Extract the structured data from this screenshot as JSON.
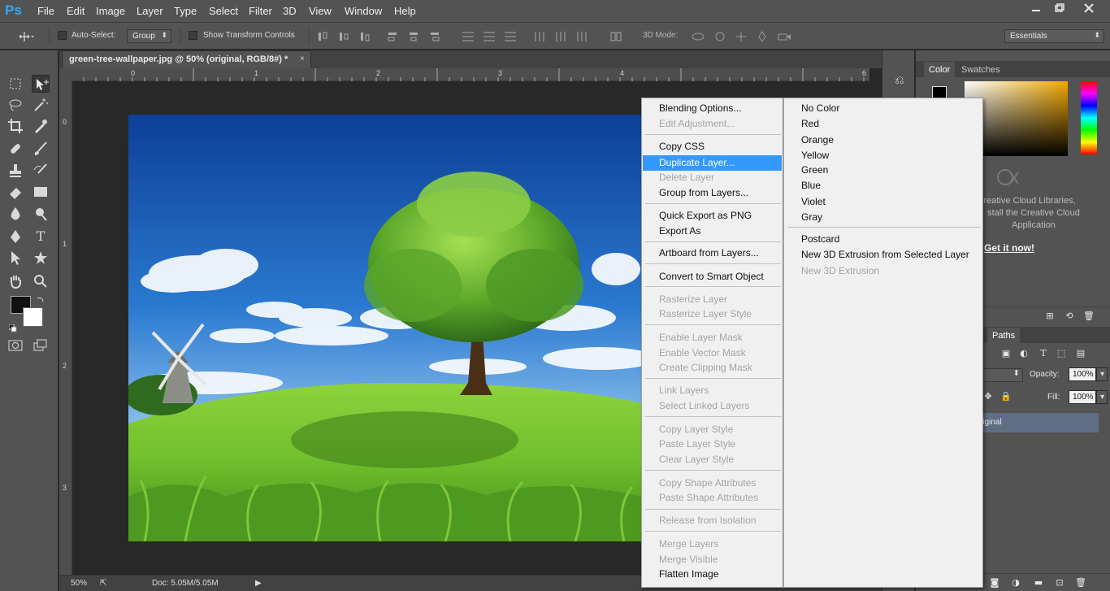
{
  "app": {
    "logo": "Ps",
    "menu": [
      "File",
      "Edit",
      "Image",
      "Layer",
      "Type",
      "Select",
      "Filter",
      "3D",
      "View",
      "Window",
      "Help"
    ],
    "window_controls": [
      "minimize-icon",
      "restore-icon",
      "close-icon"
    ]
  },
  "options_bar": {
    "auto_select_label": "Auto-Select:",
    "auto_select_value": "Group",
    "show_transform_label": "Show Transform Controls",
    "mode_3d_label": "3D Mode:",
    "workspace_value": "Essentials"
  },
  "document": {
    "tab_title": "green-tree-wallpaper.jpg @ 50% (original, RGB/8#) *",
    "close_glyph": "×",
    "ruler_h_numbers": [
      "0",
      "1",
      "2",
      "3",
      "4",
      "6"
    ],
    "ruler_v_numbers": [
      "0",
      "1",
      "2",
      "3"
    ]
  },
  "status_bar": {
    "zoom": "50%",
    "doc_size": "Doc: 5.05M/5.05M"
  },
  "color_panel": {
    "tabs": [
      "Color",
      "Swatches"
    ],
    "active_tab": "Color"
  },
  "libraries_panel": {
    "line1": "reative Cloud Libraries,",
    "line2": "stall the Creative Cloud",
    "line3": "Application",
    "link": "Get it now!"
  },
  "layers_panel": {
    "tab_paths": "Paths",
    "tab_partial": "s",
    "opacity_label": "Opacity:",
    "opacity_value": "100%",
    "fill_label": "Fill:",
    "fill_value": "100%",
    "layer_name": "riginal"
  },
  "context_menu_main": {
    "items": [
      {
        "label": "Blending Options...",
        "state": "enabled"
      },
      {
        "label": "Edit Adjustment...",
        "state": "disabled"
      },
      {
        "label": "Copy CSS",
        "state": "enabled"
      },
      {
        "label": "Duplicate Layer...",
        "state": "highlighted"
      },
      {
        "label": "Delete Layer",
        "state": "disabled"
      },
      {
        "label": "Group from Layers...",
        "state": "enabled"
      },
      {
        "label": "Quick Export as PNG",
        "state": "enabled"
      },
      {
        "label": "Export As",
        "state": "enabled"
      },
      {
        "label": "Artboard from Layers...",
        "state": "enabled"
      },
      {
        "label": "Convert to Smart Object",
        "state": "enabled"
      },
      {
        "label": "Rasterize Layer",
        "state": "disabled"
      },
      {
        "label": "Rasterize Layer Style",
        "state": "disabled"
      },
      {
        "label": "Enable Layer Mask",
        "state": "disabled"
      },
      {
        "label": "Enable Vector Mask",
        "state": "disabled"
      },
      {
        "label": "Create Clipping Mask",
        "state": "disabled"
      },
      {
        "label": "Link Layers",
        "state": "disabled"
      },
      {
        "label": "Select Linked Layers",
        "state": "disabled"
      },
      {
        "label": "Copy Layer Style",
        "state": "disabled"
      },
      {
        "label": "Paste Layer Style",
        "state": "disabled"
      },
      {
        "label": "Clear Layer Style",
        "state": "disabled"
      },
      {
        "label": "Copy Shape Attributes",
        "state": "disabled"
      },
      {
        "label": "Paste Shape Attributes",
        "state": "disabled"
      },
      {
        "label": "Release from Isolation",
        "state": "disabled"
      },
      {
        "label": "Merge Layers",
        "state": "disabled"
      },
      {
        "label": "Merge Visible",
        "state": "disabled"
      },
      {
        "label": "Flatten Image",
        "state": "enabled"
      }
    ]
  },
  "context_menu_color": {
    "items": [
      {
        "label": "No Color",
        "state": "enabled"
      },
      {
        "label": "Red",
        "state": "enabled"
      },
      {
        "label": "Orange",
        "state": "enabled"
      },
      {
        "label": "Yellow",
        "state": "enabled"
      },
      {
        "label": "Green",
        "state": "enabled"
      },
      {
        "label": "Blue",
        "state": "enabled"
      },
      {
        "label": "Violet",
        "state": "enabled"
      },
      {
        "label": "Gray",
        "state": "enabled"
      },
      {
        "label": "Postcard",
        "state": "enabled"
      },
      {
        "label": "New 3D Extrusion from Selected Layer",
        "state": "enabled"
      },
      {
        "label": "New 3D Extrusion",
        "state": "disabled"
      }
    ]
  },
  "colors": {
    "app_bg": "#535353",
    "highlight": "#3399ff",
    "brand": "#31a8ff"
  }
}
